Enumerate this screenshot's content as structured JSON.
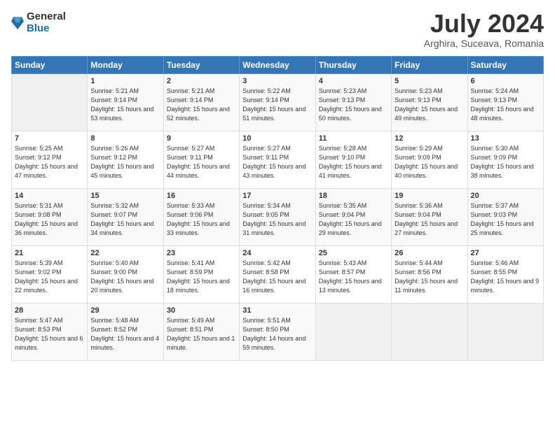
{
  "logo": {
    "general": "General",
    "blue": "Blue"
  },
  "title": "July 2024",
  "subtitle": "Arghira, Suceava, Romania",
  "headers": [
    "Sunday",
    "Monday",
    "Tuesday",
    "Wednesday",
    "Thursday",
    "Friday",
    "Saturday"
  ],
  "weeks": [
    [
      {
        "day": "",
        "sunrise": "",
        "sunset": "",
        "daylight": ""
      },
      {
        "day": "1",
        "sunrise": "Sunrise: 5:21 AM",
        "sunset": "Sunset: 9:14 PM",
        "daylight": "Daylight: 15 hours and 53 minutes."
      },
      {
        "day": "2",
        "sunrise": "Sunrise: 5:21 AM",
        "sunset": "Sunset: 9:14 PM",
        "daylight": "Daylight: 15 hours and 52 minutes."
      },
      {
        "day": "3",
        "sunrise": "Sunrise: 5:22 AM",
        "sunset": "Sunset: 9:14 PM",
        "daylight": "Daylight: 15 hours and 51 minutes."
      },
      {
        "day": "4",
        "sunrise": "Sunrise: 5:23 AM",
        "sunset": "Sunset: 9:13 PM",
        "daylight": "Daylight: 15 hours and 50 minutes."
      },
      {
        "day": "5",
        "sunrise": "Sunrise: 5:23 AM",
        "sunset": "Sunset: 9:13 PM",
        "daylight": "Daylight: 15 hours and 49 minutes."
      },
      {
        "day": "6",
        "sunrise": "Sunrise: 5:24 AM",
        "sunset": "Sunset: 9:13 PM",
        "daylight": "Daylight: 15 hours and 48 minutes."
      }
    ],
    [
      {
        "day": "7",
        "sunrise": "Sunrise: 5:25 AM",
        "sunset": "Sunset: 9:12 PM",
        "daylight": "Daylight: 15 hours and 47 minutes."
      },
      {
        "day": "8",
        "sunrise": "Sunrise: 5:26 AM",
        "sunset": "Sunset: 9:12 PM",
        "daylight": "Daylight: 15 hours and 45 minutes."
      },
      {
        "day": "9",
        "sunrise": "Sunrise: 5:27 AM",
        "sunset": "Sunset: 9:11 PM",
        "daylight": "Daylight: 15 hours and 44 minutes."
      },
      {
        "day": "10",
        "sunrise": "Sunrise: 5:27 AM",
        "sunset": "Sunset: 9:11 PM",
        "daylight": "Daylight: 15 hours and 43 minutes."
      },
      {
        "day": "11",
        "sunrise": "Sunrise: 5:28 AM",
        "sunset": "Sunset: 9:10 PM",
        "daylight": "Daylight: 15 hours and 41 minutes."
      },
      {
        "day": "12",
        "sunrise": "Sunrise: 5:29 AM",
        "sunset": "Sunset: 9:09 PM",
        "daylight": "Daylight: 15 hours and 40 minutes."
      },
      {
        "day": "13",
        "sunrise": "Sunrise: 5:30 AM",
        "sunset": "Sunset: 9:09 PM",
        "daylight": "Daylight: 15 hours and 38 minutes."
      }
    ],
    [
      {
        "day": "14",
        "sunrise": "Sunrise: 5:31 AM",
        "sunset": "Sunset: 9:08 PM",
        "daylight": "Daylight: 15 hours and 36 minutes."
      },
      {
        "day": "15",
        "sunrise": "Sunrise: 5:32 AM",
        "sunset": "Sunset: 9:07 PM",
        "daylight": "Daylight: 15 hours and 34 minutes."
      },
      {
        "day": "16",
        "sunrise": "Sunrise: 5:33 AM",
        "sunset": "Sunset: 9:06 PM",
        "daylight": "Daylight: 15 hours and 33 minutes."
      },
      {
        "day": "17",
        "sunrise": "Sunrise: 5:34 AM",
        "sunset": "Sunset: 9:05 PM",
        "daylight": "Daylight: 15 hours and 31 minutes."
      },
      {
        "day": "18",
        "sunrise": "Sunrise: 5:35 AM",
        "sunset": "Sunset: 9:04 PM",
        "daylight": "Daylight: 15 hours and 29 minutes."
      },
      {
        "day": "19",
        "sunrise": "Sunrise: 5:36 AM",
        "sunset": "Sunset: 9:04 PM",
        "daylight": "Daylight: 15 hours and 27 minutes."
      },
      {
        "day": "20",
        "sunrise": "Sunrise: 5:37 AM",
        "sunset": "Sunset: 9:03 PM",
        "daylight": "Daylight: 15 hours and 25 minutes."
      }
    ],
    [
      {
        "day": "21",
        "sunrise": "Sunrise: 5:39 AM",
        "sunset": "Sunset: 9:02 PM",
        "daylight": "Daylight: 15 hours and 22 minutes."
      },
      {
        "day": "22",
        "sunrise": "Sunrise: 5:40 AM",
        "sunset": "Sunset: 9:00 PM",
        "daylight": "Daylight: 15 hours and 20 minutes."
      },
      {
        "day": "23",
        "sunrise": "Sunrise: 5:41 AM",
        "sunset": "Sunset: 8:59 PM",
        "daylight": "Daylight: 15 hours and 18 minutes."
      },
      {
        "day": "24",
        "sunrise": "Sunrise: 5:42 AM",
        "sunset": "Sunset: 8:58 PM",
        "daylight": "Daylight: 15 hours and 16 minutes."
      },
      {
        "day": "25",
        "sunrise": "Sunrise: 5:43 AM",
        "sunset": "Sunset: 8:57 PM",
        "daylight": "Daylight: 15 hours and 13 minutes."
      },
      {
        "day": "26",
        "sunrise": "Sunrise: 5:44 AM",
        "sunset": "Sunset: 8:56 PM",
        "daylight": "Daylight: 15 hours and 11 minutes."
      },
      {
        "day": "27",
        "sunrise": "Sunrise: 5:46 AM",
        "sunset": "Sunset: 8:55 PM",
        "daylight": "Daylight: 15 hours and 9 minutes."
      }
    ],
    [
      {
        "day": "28",
        "sunrise": "Sunrise: 5:47 AM",
        "sunset": "Sunset: 8:53 PM",
        "daylight": "Daylight: 15 hours and 6 minutes."
      },
      {
        "day": "29",
        "sunrise": "Sunrise: 5:48 AM",
        "sunset": "Sunset: 8:52 PM",
        "daylight": "Daylight: 15 hours and 4 minutes."
      },
      {
        "day": "30",
        "sunrise": "Sunrise: 5:49 AM",
        "sunset": "Sunset: 8:51 PM",
        "daylight": "Daylight: 15 hours and 1 minute."
      },
      {
        "day": "31",
        "sunrise": "Sunrise: 5:51 AM",
        "sunset": "Sunset: 8:50 PM",
        "daylight": "Daylight: 14 hours and 59 minutes."
      },
      {
        "day": "",
        "sunrise": "",
        "sunset": "",
        "daylight": ""
      },
      {
        "day": "",
        "sunrise": "",
        "sunset": "",
        "daylight": ""
      },
      {
        "day": "",
        "sunrise": "",
        "sunset": "",
        "daylight": ""
      }
    ]
  ]
}
